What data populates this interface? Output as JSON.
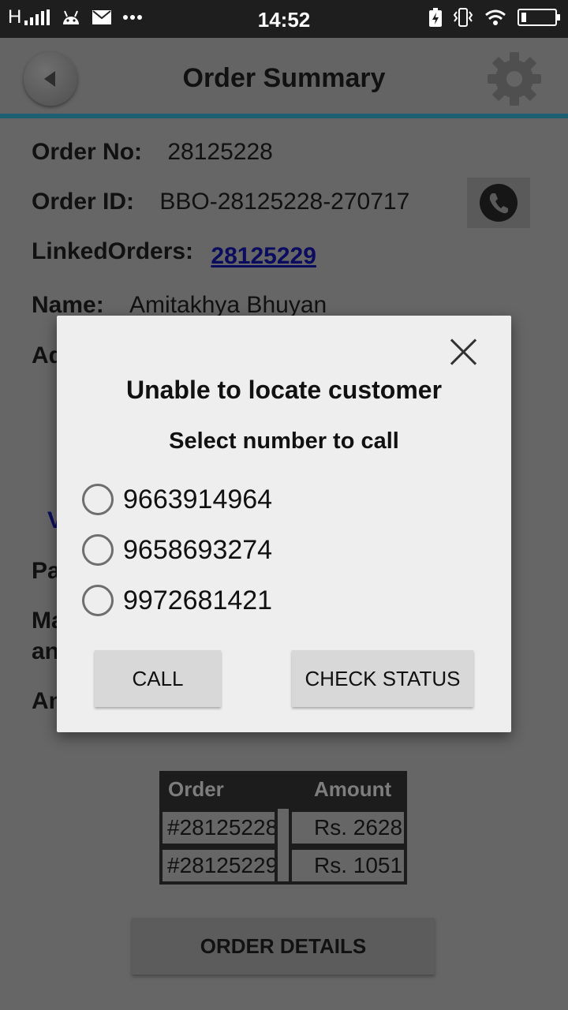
{
  "status_bar": {
    "carrier": "H",
    "time": "14:52"
  },
  "header": {
    "title": "Order Summary"
  },
  "order": {
    "order_no_label": "Order No:",
    "order_no": "28125228",
    "order_id_label": "Order ID:",
    "order_id": "BBO-28125228-270717",
    "linked_label": "LinkedOrders:",
    "linked_value": "28125229",
    "name_label": "Name:",
    "name_value": "Amitakhya Bhuyan",
    "address_label_partial": "Ad",
    "view_partial": "V",
    "pa_partial": "Pa",
    "ma_partial": "Ma",
    "an_partial": "an",
    "amount_partial": "An"
  },
  "orders_table": {
    "headers": [
      "Order",
      "Amount"
    ],
    "rows": [
      {
        "order": "#28125228",
        "amount": "Rs. 2628"
      },
      {
        "order": "#28125229",
        "amount": "Rs. 1051"
      }
    ]
  },
  "order_details_button": "ORDER DETAILS",
  "dialog": {
    "title": "Unable to locate customer",
    "subtitle": "Select number to call",
    "numbers": [
      "9663914964",
      "9658693274",
      "9972681421"
    ],
    "call_button": "CALL",
    "check_status_button": "CHECK STATUS"
  }
}
